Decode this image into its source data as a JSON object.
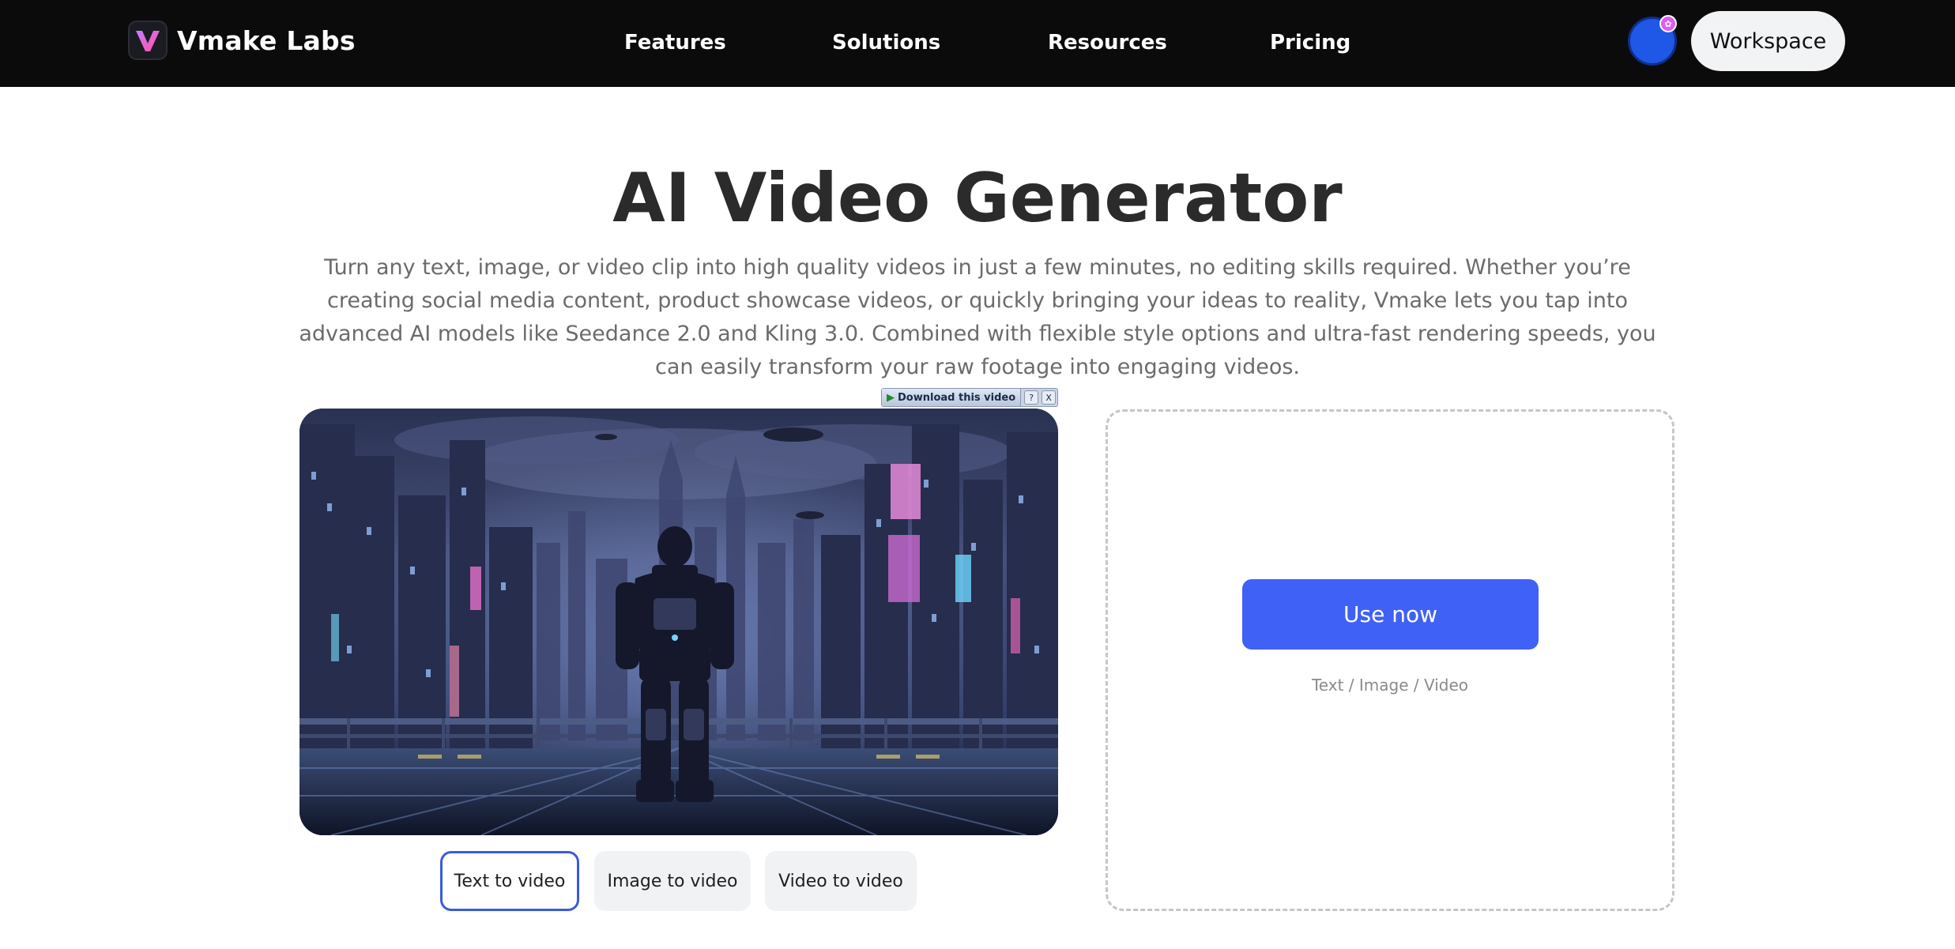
{
  "nav": {
    "brand": "Vmake Labs",
    "brand_logo_icon": "vmake-v-logo-icon",
    "items": [
      "Features",
      "Solutions",
      "Resources",
      "Pricing"
    ],
    "workspace_label": "Workspace",
    "colors": {
      "background": "#0b0b0b",
      "avatar": "#1f57e6",
      "badge": "#e05cf2"
    }
  },
  "hero": {
    "title": "AI Video Generator",
    "subtitle": "Turn any text, image, or video clip into high quality videos in just a few minutes, no editing skills required. Whether you’re creating social media content, product showcase videos, or quickly bringing your ideas to reality, Vmake lets you tap into advanced AI models like Seedance 2.0 and Kling 3.0. Combined with flexible style options and ultra-fast rendering speeds, you can easily transform your raw footage into engaging videos."
  },
  "download_bar": {
    "label": "Download this video",
    "help": "?",
    "close": "X"
  },
  "preview": {
    "icon": "armored-soldier-cityscape-video"
  },
  "tabs": [
    {
      "label": "Text to video",
      "active": true
    },
    {
      "label": "Image to video",
      "active": false
    },
    {
      "label": "Video to video",
      "active": false
    }
  ],
  "panel": {
    "button_label": "Use now",
    "caption": "Text / Image / Video",
    "accent": "#4061f5"
  }
}
